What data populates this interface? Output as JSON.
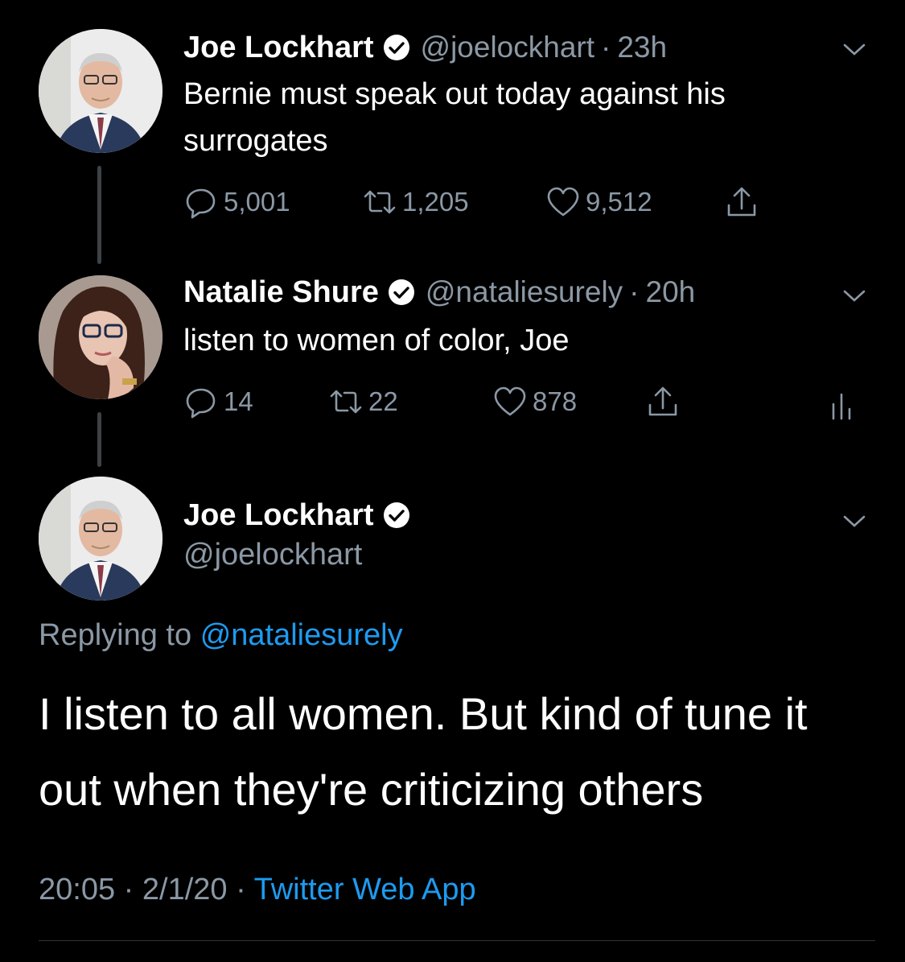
{
  "thread": [
    {
      "name": "Joe Lockhart",
      "handle": "@joelockhart",
      "time": "23h",
      "text": "Bernie must speak out today against his surrogates",
      "replies": "5,001",
      "retweets": "1,205",
      "likes": "9,512"
    },
    {
      "name": "Natalie Shure",
      "handle": "@nataliesurely",
      "time": "20h",
      "text": "listen to women of color, Joe",
      "replies": "14",
      "retweets": "22",
      "likes": "878"
    }
  ],
  "main": {
    "name": "Joe Lockhart",
    "handle": "@joelockhart",
    "replying_prefix": "Replying to",
    "replying_to": "@nataliesurely",
    "text": "I listen to all women.  But kind of tune it out when they're criticizing others",
    "time": "20:05",
    "date": "2/1/20",
    "source": "Twitter Web App"
  },
  "separator": "·",
  "colors": {
    "background": "#000000",
    "secondary_text": "#8b98a5",
    "link": "#1d9bf0",
    "thread_line": "#3d4246"
  },
  "icons": [
    "verified-badge-icon",
    "chevron-down-icon",
    "reply-icon",
    "retweet-icon",
    "like-icon",
    "share-icon",
    "analytics-icon"
  ]
}
